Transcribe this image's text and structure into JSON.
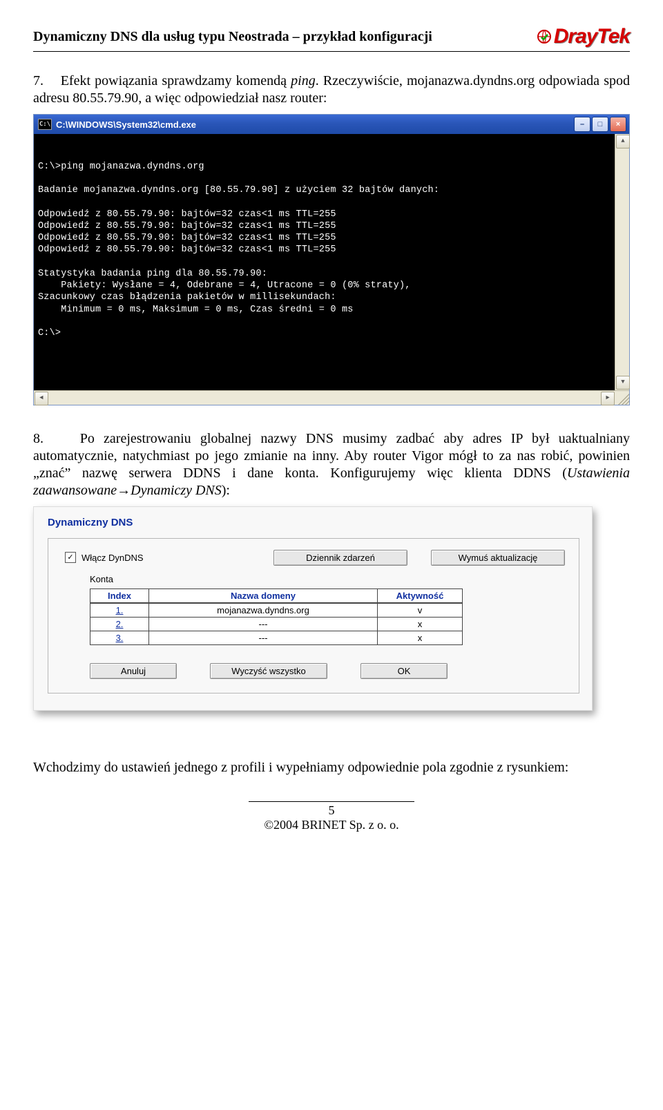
{
  "header": {
    "title": "Dynamiczny DNS dla usług typu Neostrada – przykład konfiguracji",
    "logo_text": "DrayTek"
  },
  "p1_a": "7.",
  "p1_b": "Efekt powiązania sprawdzamy komendą ",
  "p1_ping": "ping",
  "p1_c": ". Rzeczywiście, mojanazwa.dyndns.org odpowiada spod adresu 80.55.79.90, a więc odpowiedział nasz router:",
  "cmd": {
    "title_icon": "C:\\",
    "title": "C:\\WINDOWS\\System32\\cmd.exe",
    "lines": [
      "C:\\>ping mojanazwa.dyndns.org",
      "",
      "Badanie mojanazwa.dyndns.org [80.55.79.90] z użyciem 32 bajtów danych:",
      "",
      "Odpowiedź z 80.55.79.90: bajtów=32 czas<1 ms TTL=255",
      "Odpowiedź z 80.55.79.90: bajtów=32 czas<1 ms TTL=255",
      "Odpowiedź z 80.55.79.90: bajtów=32 czas<1 ms TTL=255",
      "Odpowiedź z 80.55.79.90: bajtów=32 czas<1 ms TTL=255",
      "",
      "Statystyka badania ping dla 80.55.79.90:",
      "    Pakiety: Wysłane = 4, Odebrane = 4, Utracone = 0 (0% straty),",
      "Szacunkowy czas błądzenia pakietów w millisekundach:",
      "    Minimum = 0 ms, Maksimum = 0 ms, Czas średni = 0 ms",
      "",
      "C:\\>"
    ]
  },
  "p2_a": "8.",
  "p2_b": "Po zarejestrowaniu globalnej nazwy DNS musimy zadbać aby adres IP był uaktualniany automatycznie, natychmiast po jego zmianie na inny. Aby router Vigor mógł to za nas robić, powinien „znać” nazwę serwera DDNS i dane konta. Konfigurujemy więc klienta DDNS (",
  "p2_path": "Ustawienia zaawansowane→Dynamiczy DNS",
  "p2_c": "):",
  "dlg": {
    "title": "Dynamiczny DNS",
    "enable_label": "Włącz DynDNS",
    "enable_checked": "✓",
    "btn_log": "Dziennik zdarzeń",
    "btn_force": "Wymuś aktualizację",
    "konto": "Konta",
    "thead": {
      "index": "Index",
      "domain": "Nazwa domeny",
      "active": "Aktywność"
    },
    "rows": [
      {
        "index": "1.",
        "domain": "mojanazwa.dyndns.org",
        "active": "v"
      },
      {
        "index": "2.",
        "domain": "---",
        "active": "x"
      },
      {
        "index": "3.",
        "domain": "---",
        "active": "x"
      }
    ],
    "btn_cancel": "Anuluj",
    "btn_clear": "Wyczyść wszystko",
    "btn_ok": "OK"
  },
  "p3": "Wchodzimy do ustawień jednego z profili i wypełniamy odpowiednie pola zgodnie z rysunkiem:",
  "footer": {
    "pagenum": "5",
    "copyright": "©2004 BRINET Sp. z  o.  o."
  }
}
